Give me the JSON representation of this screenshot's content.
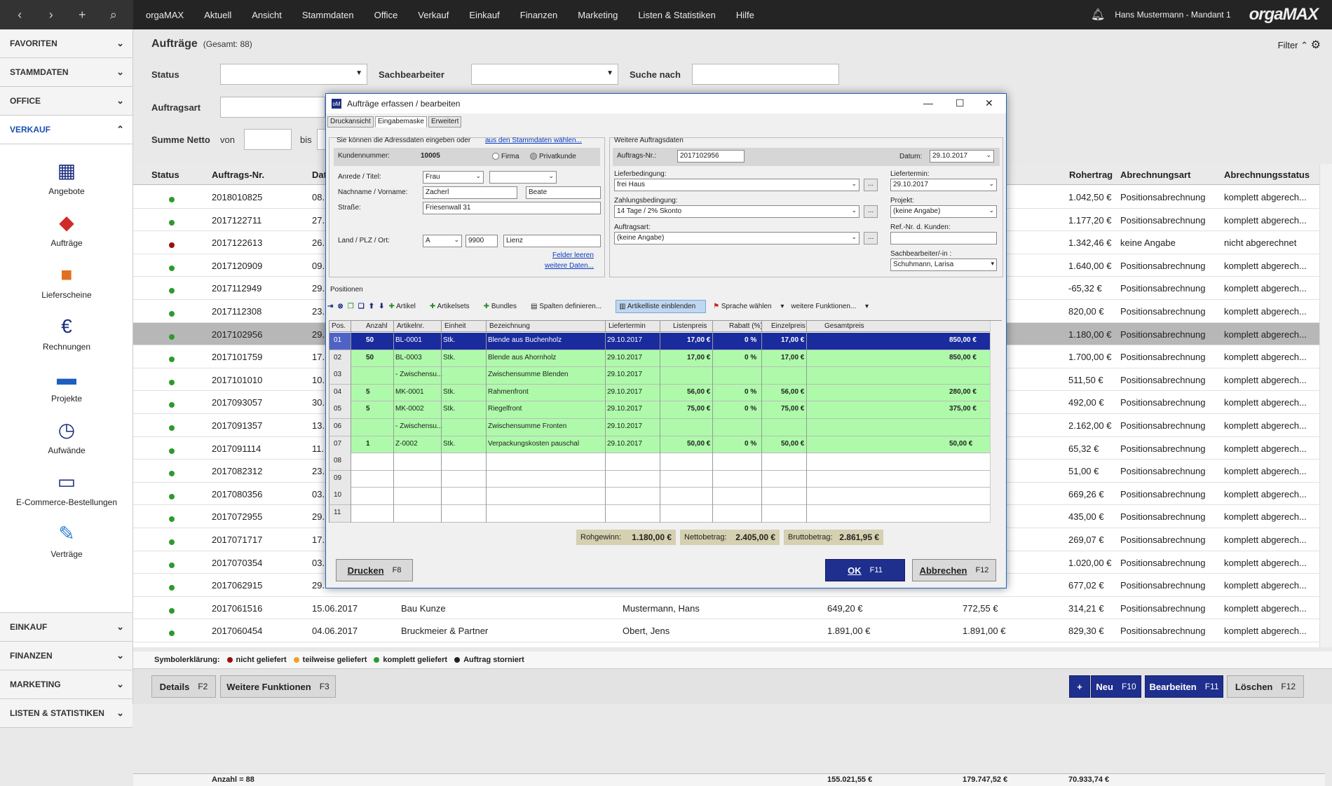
{
  "topbar": {
    "app": "orgaMAX",
    "menu": [
      "Aktuell",
      "Ansicht",
      "Stammdaten",
      "Office",
      "Verkauf",
      "Einkauf",
      "Finanzen",
      "Marketing",
      "Listen & Statistiken",
      "Hilfe"
    ],
    "user": "Hans Mustermann - Mandant 1",
    "logo_a": "orga",
    "logo_b": "MAX"
  },
  "sidebar": {
    "top": [
      "FAVORITEN",
      "STAMMDATEN",
      "OFFICE",
      "VERKAUF"
    ],
    "items": [
      "Angebote",
      "Aufträge",
      "Lieferscheine",
      "Rechnungen",
      "Projekte",
      "Aufwände",
      "E-Commerce-Bestellungen",
      "Verträge"
    ],
    "bottom": [
      "EINKAUF",
      "FINANZEN",
      "MARKETING",
      "LISTEN & STATISTIKEN"
    ]
  },
  "page": {
    "title": "Aufträge",
    "count": "(Gesamt: 88)",
    "filter": "Filter"
  },
  "filters": {
    "status": "Status",
    "sachbearbeiter": "Sachbearbeiter",
    "suche": "Suche nach",
    "auftragsart": "Auftragsart",
    "summe": "Summe Netto",
    "von": "von",
    "bis": "bis"
  },
  "grid": {
    "headers": {
      "status": "Status",
      "nr": "Auftrags-Nr.",
      "dat": "Dat",
      "rohertrag": "Rohertrag",
      "abrart": "Abrechnungsart",
      "abrstatus": "Abrechnungsstatus"
    },
    "rows": [
      {
        "s": "green",
        "nr": "2018010825",
        "d": "08.",
        "r": "1.042,50 €",
        "a": "Positionsabrechnung",
        "st": "komplett abgerech..."
      },
      {
        "s": "green",
        "nr": "2017122711",
        "d": "27.",
        "r": "1.177,20 €",
        "a": "Positionsabrechnung",
        "st": "komplett abgerech..."
      },
      {
        "s": "red",
        "nr": "2017122613",
        "d": "26.",
        "r": "1.342,46 €",
        "a": "keine Angabe",
        "st": "nicht abgerechnet"
      },
      {
        "s": "green",
        "nr": "2017120909",
        "d": "09.",
        "r": "1.640,00 €",
        "a": "Positionsabrechnung",
        "st": "komplett abgerech..."
      },
      {
        "s": "green",
        "nr": "2017112949",
        "d": "29.",
        "r": "-65,32 €",
        "a": "Positionsabrechnung",
        "st": "komplett abgerech..."
      },
      {
        "s": "green",
        "nr": "2017112308",
        "d": "23.",
        "r": "820,00 €",
        "a": "Positionsabrechnung",
        "st": "komplett abgerech..."
      },
      {
        "s": "green",
        "nr": "2017102956",
        "d": "29.",
        "r": "1.180,00 €",
        "a": "Positionsabrechnung",
        "st": "komplett abgerech..."
      },
      {
        "s": "green",
        "nr": "2017101759",
        "d": "17.",
        "r": "1.700,00 €",
        "a": "Positionsabrechnung",
        "st": "komplett abgerech..."
      },
      {
        "s": "green",
        "nr": "2017101010",
        "d": "10.",
        "r": "511,50 €",
        "a": "Positionsabrechnung",
        "st": "komplett abgerech..."
      },
      {
        "s": "green",
        "nr": "2017093057",
        "d": "30.",
        "r": "492,00 €",
        "a": "Positionsabrechnung",
        "st": "komplett abgerech..."
      },
      {
        "s": "green",
        "nr": "2017091357",
        "d": "13.",
        "r": "2.162,00 €",
        "a": "Positionsabrechnung",
        "st": "komplett abgerech..."
      },
      {
        "s": "green",
        "nr": "2017091114",
        "d": "11.",
        "r": "65,32 €",
        "a": "Positionsabrechnung",
        "st": "komplett abgerech..."
      },
      {
        "s": "green",
        "nr": "2017082312",
        "d": "23.",
        "r": "51,00 €",
        "a": "Positionsabrechnung",
        "st": "komplett abgerech..."
      },
      {
        "s": "green",
        "nr": "2017080356",
        "d": "03.",
        "r": "669,26 €",
        "a": "Positionsabrechnung",
        "st": "komplett abgerech..."
      },
      {
        "s": "green",
        "nr": "2017072955",
        "d": "29.",
        "r": "435,00 €",
        "a": "Positionsabrechnung",
        "st": "komplett abgerech..."
      },
      {
        "s": "green",
        "nr": "2017071717",
        "d": "17.",
        "r": "269,07 €",
        "a": "Positionsabrechnung",
        "st": "komplett abgerech..."
      },
      {
        "s": "green",
        "nr": "2017070354",
        "d": "03.",
        "r": "1.020,00 €",
        "a": "Positionsabrechnung",
        "st": "komplett abgerech..."
      },
      {
        "s": "green",
        "nr": "2017062915",
        "d": "29.",
        "r": "677,02 €",
        "a": "Positionsabrechnung",
        "st": "komplett abgerech..."
      },
      {
        "s": "green",
        "nr": "2017061516",
        "d": "15.06.2017",
        "k": "Bau Kunze",
        "p": "Mustermann, Hans",
        "n": "649,20 €",
        "b": "772,55 €",
        "r": "314,21 €",
        "a": "Positionsabrechnung",
        "st": "komplett abgerech..."
      },
      {
        "s": "green",
        "nr": "2017060454",
        "d": "04.06.2017",
        "k": "Bruckmeier & Partner",
        "p": "Obert, Jens",
        "n": "1.891,00 €",
        "b": "1.891,00 €",
        "r": "829,30 €",
        "a": "Positionsabrechnung",
        "st": "komplett abgerech..."
      }
    ],
    "sum_count": "Anzahl = 88",
    "sum_n": "155.021,55 €",
    "sum_b": "179.747,52 €",
    "sum_r": "70.933,74 €"
  },
  "legend": {
    "title": "Symbolerklärung:",
    "a": "nicht geliefert",
    "b": "teilweise geliefert",
    "c": "komplett geliefert",
    "d": "Auftrag storniert"
  },
  "bottom": {
    "details": "Details",
    "details_k": "F2",
    "weitere": "Weitere Funktionen",
    "weitere_k": "F3",
    "neu": "Neu",
    "neu_k": "F10",
    "bearbeiten": "Bearbeiten",
    "bearbeiten_k": "F11",
    "loeschen": "Löschen",
    "loeschen_k": "F12",
    "plus": "+"
  },
  "dialog": {
    "title": "Aufträge erfassen / bearbeiten",
    "tabs": [
      "Druckansicht",
      "Eingabemaske",
      "Erweitert"
    ],
    "addr_hint": "Sie können die Adressdaten eingeben oder",
    "addr_link": "aus den Stammdaten wählen...",
    "kundennr_l": "Kundennummer:",
    "kundennr": "10005",
    "firma": "Firma",
    "privat": "Privatkunde",
    "anrede_l": "Anrede / Titel:",
    "anrede": "Frau",
    "name_l": "Nachname / Vorname:",
    "nachname": "Zacherl",
    "vorname": "Beate",
    "strasse_l": "Straße:",
    "strasse": "Friesenwall 31",
    "ort_l": "Land / PLZ / Ort:",
    "land": "A",
    "plz": "9900",
    "ort": "Lienz",
    "felder": "Felder leeren",
    "weitere": "weitere Daten...",
    "weitere_t": "Weitere Auftragsdaten",
    "auftragsnr_l": "Auftrags-Nr.:",
    "auftragsnr": "2017102956",
    "datum_l": "Datum:",
    "datum": "29.10.2017",
    "lieferbed_l": "Lieferbedingung:",
    "lieferbed": "frei Haus",
    "liefertermin_l": "Liefertermin:",
    "liefertermin": "29.10.2017",
    "zahlbed_l": "Zahlungsbedingung:",
    "zahlbed": "14 Tage / 2% Skonto",
    "projekt_l": "Projekt:",
    "projekt": "(keine Angabe)",
    "auftragsart_l": "Auftragsart:",
    "auftragsart": "(keine Angabe)",
    "refnr_l": "Ref.-Nr. d. Kunden:",
    "sachb_l": "Sachbearbeiter/-in :",
    "sachb": "Schuhmann, Larisa",
    "ellipsis": "...",
    "positionen": "Positionen",
    "toolbar": {
      "artikel": "Artikel",
      "artikelsets": "Artikelsets",
      "bundles": "Bundles",
      "spalten": "Spalten definieren...",
      "artikelliste": "Artikelliste einblenden",
      "sprache": "Sprache wählen",
      "weitere": "weitere Funktionen..."
    },
    "cols": [
      "Pos.",
      "Anzahl",
      "Artikelnr.",
      "Einheit",
      "Bezeichnung",
      "Liefertermin",
      "Listenpreis",
      "Rabatt (%)",
      "Einzelpreis",
      "Gesamtpreis"
    ],
    "rows": [
      {
        "pos": "01",
        "anz": "50",
        "art": "BL-0001",
        "ein": "Stk.",
        "bez": "Blende aus Buchenholz",
        "lt": "29.10.2017",
        "lp": "17,00 €",
        "rb": "0 %",
        "ep": "17,00 €",
        "gp": "850,00 €"
      },
      {
        "pos": "02",
        "anz": "50",
        "art": "BL-0003",
        "ein": "Stk.",
        "bez": "Blende aus Ahornholz",
        "lt": "29.10.2017",
        "lp": "17,00 €",
        "rb": "0 %",
        "ep": "17,00 €",
        "gp": "850,00 €"
      },
      {
        "pos": "03",
        "anz": "",
        "art": "- Zwischensu...",
        "ein": "",
        "bez": "Zwischensumme Blenden",
        "lt": "29.10.2017",
        "lp": "",
        "rb": "",
        "ep": "",
        "gp": ""
      },
      {
        "pos": "04",
        "anz": "5",
        "art": "MK-0001",
        "ein": "Stk.",
        "bez": "Rahmenfront",
        "lt": "29.10.2017",
        "lp": "56,00 €",
        "rb": "0 %",
        "ep": "56,00 €",
        "gp": "280,00 €"
      },
      {
        "pos": "05",
        "anz": "5",
        "art": "MK-0002",
        "ein": "Stk.",
        "bez": "Riegelfront",
        "lt": "29.10.2017",
        "lp": "75,00 €",
        "rb": "0 %",
        "ep": "75,00 €",
        "gp": "375,00 €"
      },
      {
        "pos": "06",
        "anz": "",
        "art": "- Zwischensu...",
        "ein": "",
        "bez": "Zwischensumme Fronten",
        "lt": "29.10.2017",
        "lp": "",
        "rb": "",
        "ep": "",
        "gp": ""
      },
      {
        "pos": "07",
        "anz": "1",
        "art": "Z-0002",
        "ein": "Stk.",
        "bez": "Verpackungskosten pauschal",
        "lt": "29.10.2017",
        "lp": "50,00 €",
        "rb": "0 %",
        "ep": "50,00 €",
        "gp": "50,00 €"
      },
      {
        "pos": "08"
      },
      {
        "pos": "09"
      },
      {
        "pos": "10"
      },
      {
        "pos": "11"
      }
    ],
    "rohgewinn_l": "Rohgewinn:",
    "rohgewinn": "1.180,00 €",
    "netto_l": "Nettobetrag:",
    "netto": "2.405,00 €",
    "brutto_l": "Bruttobetrag:",
    "brutto": "2.861,95 €",
    "drucken": "Drucken",
    "drucken_k": "F8",
    "ok": "OK",
    "ok_k": "F11",
    "abbrechen": "Abbrechen",
    "abbrechen_k": "F12"
  },
  "colors": {
    "topbar": "#242424",
    "accent": "#1e2f8e",
    "green": "#2e9a2e",
    "red": "#9a1010",
    "orange": "#f0a020",
    "rowgreen": "#aefaaa"
  }
}
